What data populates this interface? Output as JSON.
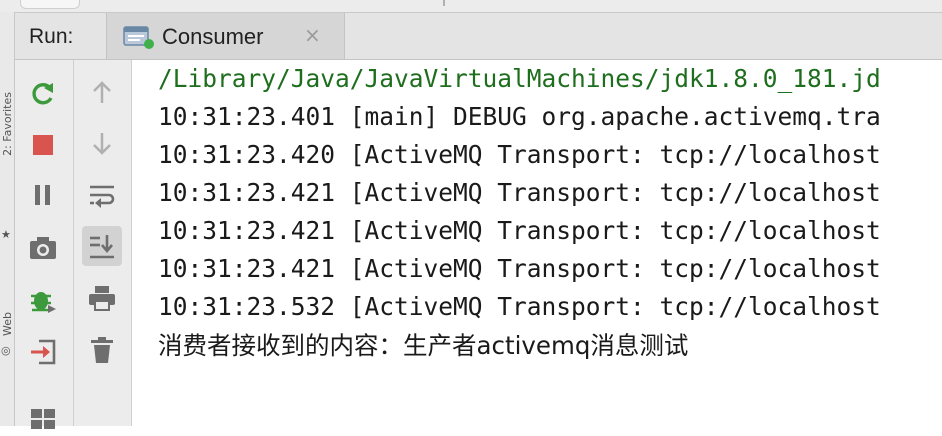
{
  "run_panel": {
    "label": "Run:",
    "tab": {
      "label": "Consumer",
      "close_icon": "close-icon"
    }
  },
  "edge_stripe": {
    "label_top": "2: Favorites",
    "label_bottom": "Web"
  },
  "toolbar_left": [
    {
      "name": "rerun-button",
      "icon": "rerun-icon"
    },
    {
      "name": "stop-button",
      "icon": "stop-icon"
    },
    {
      "name": "pause-button",
      "icon": "pause-icon"
    },
    {
      "name": "dump-threads-button",
      "icon": "camera-icon"
    },
    {
      "name": "debug-button",
      "icon": "bug-icon"
    },
    {
      "name": "exit-button",
      "icon": "exit-icon"
    },
    {
      "name": "layout-button",
      "icon": "layout-icon"
    }
  ],
  "toolbar_right": [
    {
      "name": "up-stack-button",
      "icon": "arrow-up-icon"
    },
    {
      "name": "down-stack-button",
      "icon": "arrow-down-icon"
    },
    {
      "name": "soft-wrap-button",
      "icon": "wrap-icon"
    },
    {
      "name": "scroll-to-end-button",
      "icon": "scroll-end-icon",
      "active": true
    },
    {
      "name": "print-button",
      "icon": "print-icon"
    },
    {
      "name": "clear-button",
      "icon": "trash-icon"
    }
  ],
  "console": {
    "lines": [
      "/Library/Java/JavaVirtualMachines/jdk1.8.0_181.jd",
      "10:31:23.401 [main] DEBUG org.apache.activemq.tra",
      "10:31:23.420 [ActiveMQ Transport: tcp://localhost",
      "10:31:23.421 [ActiveMQ Transport: tcp://localhost",
      "10:31:23.421 [ActiveMQ Transport: tcp://localhost",
      "10:31:23.421 [ActiveMQ Transport: tcp://localhost",
      "10:31:23.532 [ActiveMQ Transport: tcp://localhost",
      "消费者接收到的内容：生产者activemq消息测试"
    ]
  },
  "colors": {
    "command_text": "#1e6e1e",
    "rerun_green": "#3c9a3c",
    "stop_red": "#d9534f",
    "icon_gray": "#6e6e6e"
  }
}
